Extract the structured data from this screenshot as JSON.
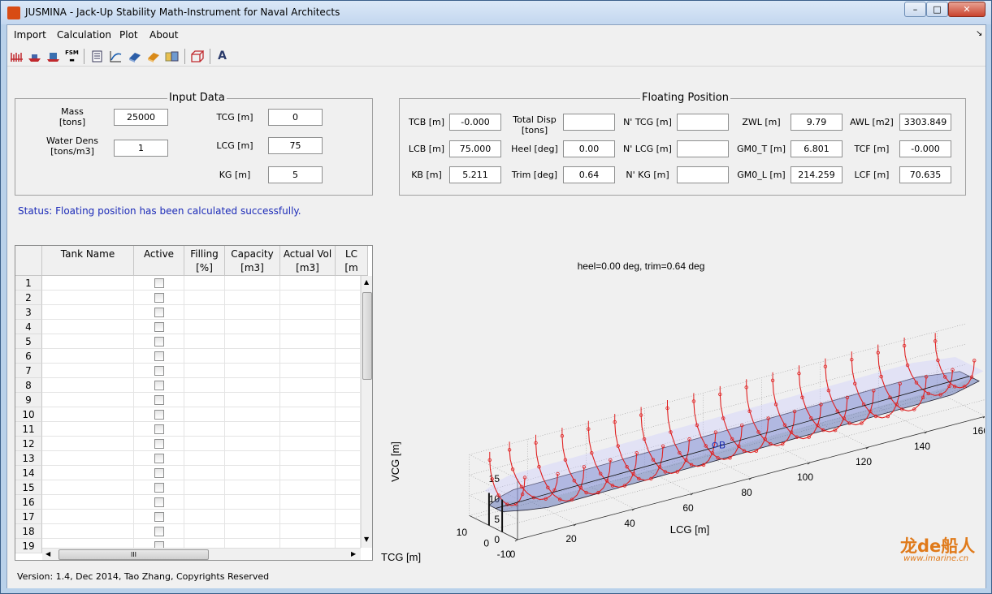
{
  "window": {
    "title": "JUSMINA - Jack-Up Stability Math-Instrument for Naval Architects",
    "min": "–",
    "max": "□",
    "close": "✕"
  },
  "menu": [
    "Import",
    "Calculation",
    "Plot",
    "About"
  ],
  "menu_overflow": "↘",
  "toolbar": {
    "icons": [
      "hull-lines-icon",
      "vessel-icon",
      "tank-icon",
      "fsm-icon",
      "report-icon",
      "curve-icon",
      "book-blue-icon",
      "book-orange-icon",
      "tanks-table-icon",
      "box-3d-icon",
      "font-icon"
    ],
    "fsm_text": "FSM",
    "font_glyph": "A"
  },
  "input_data": {
    "title": "Input Data",
    "mass_label": "Mass\n[tons]",
    "mass": "25000",
    "dens_label": "Water Dens\n[tons/m3]",
    "dens": "1",
    "tcg_label": "TCG [m]",
    "tcg": "0",
    "lcg_label": "LCG [m]",
    "lcg": "75",
    "kg_label": "KG [m]",
    "kg": "5"
  },
  "floating": {
    "title": "Floating Position",
    "tcb_label": "TCB [m]",
    "tcb": "-0.000",
    "lcb_label": "LCB [m]",
    "lcb": "75.000",
    "kb_label": "KB [m]",
    "kb": "5.211",
    "disp_label": "Total Disp\n[tons]",
    "disp": "",
    "heel_label": "Heel [deg]",
    "heel": "0.00",
    "trim_label": "Trim [deg]",
    "trim": "0.64",
    "ntcg_label": "N' TCG [m]",
    "ntcg": "",
    "nlcg_label": "N' LCG [m]",
    "nlcg": "",
    "nkg_label": "N' KG [m]",
    "nkg": "",
    "zwl_label": "ZWL [m]",
    "zwl": "9.79",
    "gmt_label": "GM0_T [m]",
    "gmt": "6.801",
    "gml_label": "GM0_L [m]",
    "gml": "214.259",
    "awl_label": "AWL [m2]",
    "awl": "3303.849",
    "tcf_label": "TCF [m]",
    "tcf": "-0.000",
    "lcf_label": "LCF [m]",
    "lcf": "70.635"
  },
  "status": "Status: Floating position has been calculated successfully.",
  "table": {
    "headers": [
      "Tank Name",
      "Active",
      "Filling\n[%]",
      "Capacity\n[m3]",
      "Actual Vol\n[m3]",
      "LC\n[m"
    ],
    "rows": [
      "1",
      "2",
      "3",
      "4",
      "5",
      "6",
      "7",
      "8",
      "9",
      "10",
      "11",
      "12",
      "13",
      "14",
      "15",
      "16",
      "17",
      "18",
      "19"
    ],
    "hscroll_grip": "III"
  },
  "plot": {
    "title": "heel=0.00 deg,  trim=0.64 deg",
    "xlabel": "LCG [m]",
    "ylabel": "VCG [m]",
    "zlabel": "TCG [m]",
    "lcg_ticks": [
      "0",
      "20",
      "40",
      "60",
      "80",
      "100",
      "120",
      "140",
      "160"
    ],
    "vcg_ticks": [
      "0",
      "5",
      "10",
      "15"
    ],
    "tcg_ticks": [
      "-10",
      "0",
      "10"
    ],
    "marker": "B"
  },
  "version": "Version: 1.4, Dec 2014, Tao Zhang, Copyrights Reserved",
  "watermark": {
    "logo": "龙de船人",
    "url": "www.imarine.cn"
  },
  "colors": {
    "frame": "#e02020",
    "waterplane": "#4a5fae",
    "status": "#1c2bb8"
  }
}
